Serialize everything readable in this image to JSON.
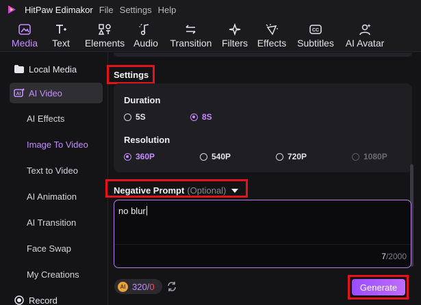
{
  "app": {
    "name": "HitPaw Edimakor"
  },
  "menu": [
    "File",
    "Settings",
    "Help"
  ],
  "toolbar": [
    {
      "label": "Media",
      "icon": "media-icon",
      "active": true
    },
    {
      "label": "Text",
      "icon": "text-icon"
    },
    {
      "label": "Elements",
      "icon": "elements-icon"
    },
    {
      "label": "Audio",
      "icon": "audio-icon"
    },
    {
      "label": "Transition",
      "icon": "transition-icon"
    },
    {
      "label": "Filters",
      "icon": "filters-icon"
    },
    {
      "label": "Effects",
      "icon": "effects-icon"
    },
    {
      "label": "Subtitles",
      "icon": "subtitles-icon"
    },
    {
      "label": "AI Avatar",
      "icon": "ai-avatar-icon"
    }
  ],
  "sidebar": {
    "local_media": "Local Media",
    "ai_video": "AI Video",
    "items": [
      "AI Effects",
      "Image To Video",
      "Text to Video",
      "AI Animation",
      "AI Transition",
      "Face Swap",
      "My Creations"
    ],
    "active_item": "Image To Video",
    "record": "Record"
  },
  "settings": {
    "title": "Settings",
    "duration_label": "Duration",
    "duration_options": [
      "5S",
      "8S"
    ],
    "duration_selected": "8S",
    "resolution_label": "Resolution",
    "resolution_options": [
      "360P",
      "540P",
      "720P",
      "1080P"
    ],
    "resolution_selected": "360P",
    "resolution_disabled": [
      "1080P"
    ]
  },
  "negative_prompt": {
    "title": "Negative Prompt",
    "optional": "(Optional)",
    "value": "no blur",
    "count": "7",
    "max": "/2000"
  },
  "credits": {
    "available": "320",
    "separator": "/",
    "cost": "0",
    "coin_label": "AI"
  },
  "generate_label": "Generate",
  "colors": {
    "accent": "#c58cff",
    "highlight": "#e3121b",
    "button": "#a855f7",
    "cost": "#ff4d6d"
  }
}
